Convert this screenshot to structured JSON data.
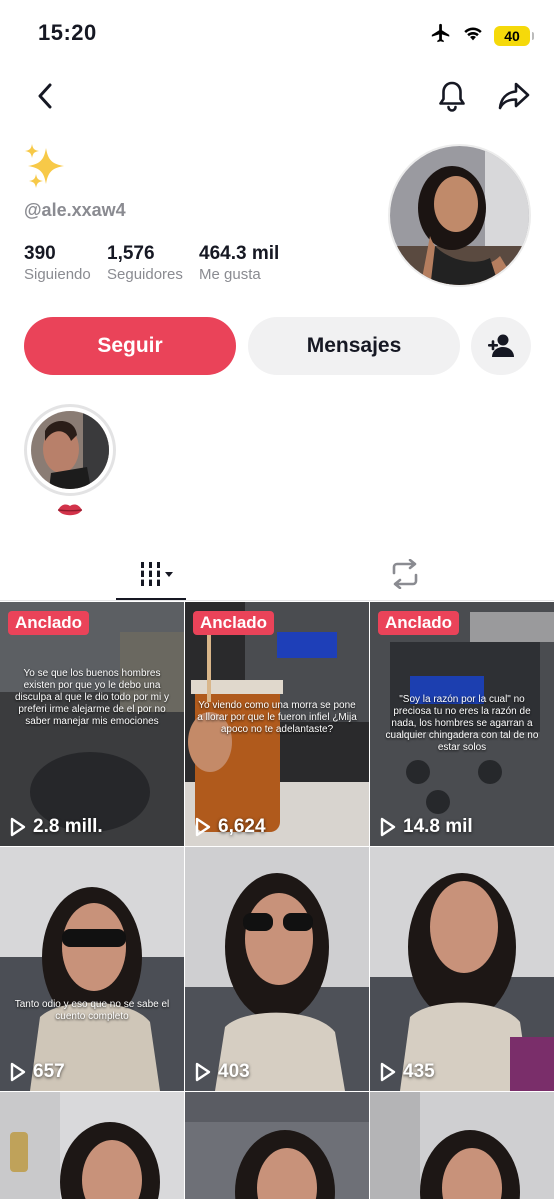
{
  "status": {
    "time": "15:20",
    "battery": "40"
  },
  "profile": {
    "username": "@ale.xxaw4",
    "stats": [
      {
        "value": "390",
        "label": "Siguiendo"
      },
      {
        "value": "1,576",
        "label": "Seguidores"
      },
      {
        "value": "464.3 mil",
        "label": "Me gusta"
      }
    ]
  },
  "actions": {
    "follow": "Seguir",
    "messages": "Mensajes"
  },
  "tabs": {
    "videos_icon": "grid-icon",
    "reposts_icon": "repost-icon"
  },
  "colors": {
    "accent": "#ea4359",
    "text": "#161823",
    "muted": "#8a8b91"
  },
  "videos": [
    {
      "pinned": "Anclado",
      "views": "2.8 mill.",
      "caption": "Yo se que los buenos hombres existen por que yo le debo una disculpa al que le dio todo por mi y preferi irme alejarme de el por no saber manejar mis emociones"
    },
    {
      "pinned": "Anclado",
      "views": "6,624",
      "caption": "Yo viendo como una morra se pone a llorar por que le fueron infiel ¿Mija apoco no te adelantaste?"
    },
    {
      "pinned": "Anclado",
      "views": "14.8 mil",
      "caption": "\"Soy la razón por la cual\" no preciosa tu no eres la razón de nada, los hombres se agarran a cualquier chingadera con tal de no estar solos"
    },
    {
      "pinned": "",
      "views": "657",
      "caption": "Tanto odio y eso que no se sabe el cuento completo"
    },
    {
      "pinned": "",
      "views": "403",
      "caption": ""
    },
    {
      "pinned": "",
      "views": "435",
      "caption": ""
    },
    {
      "pinned": "",
      "views": "",
      "caption": ""
    },
    {
      "pinned": "",
      "views": "",
      "caption": ""
    },
    {
      "pinned": "",
      "views": "",
      "caption": ""
    }
  ],
  "pinned_label": "Anclado"
}
